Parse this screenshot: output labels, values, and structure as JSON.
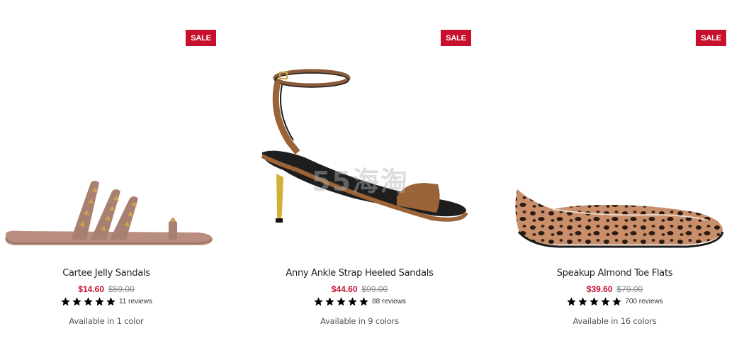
{
  "products": [
    {
      "badge": "SALE",
      "name": "Cartee Jelly Sandals",
      "sale_price": "$14.60",
      "original_price": "$59.00",
      "rating": 5,
      "reviews": "11 reviews",
      "availability": "Available in 1 color"
    },
    {
      "badge": "SALE",
      "name": "Anny Ankle Strap Heeled Sandals",
      "sale_price": "$44.60",
      "original_price": "$99.00",
      "rating": 5,
      "reviews": "88 reviews",
      "availability": "Available in 9 colors"
    },
    {
      "badge": "SALE",
      "name": "Speakup Almond Toe Flats",
      "sale_price": "$39.60",
      "original_price": "$79.00",
      "rating": 5,
      "reviews": "700 reviews",
      "availability": "Available in 16 colors"
    }
  ],
  "watermark": "55海淘",
  "colors": {
    "sale_badge": "#c8102e",
    "sale_price": "#c8102e"
  }
}
